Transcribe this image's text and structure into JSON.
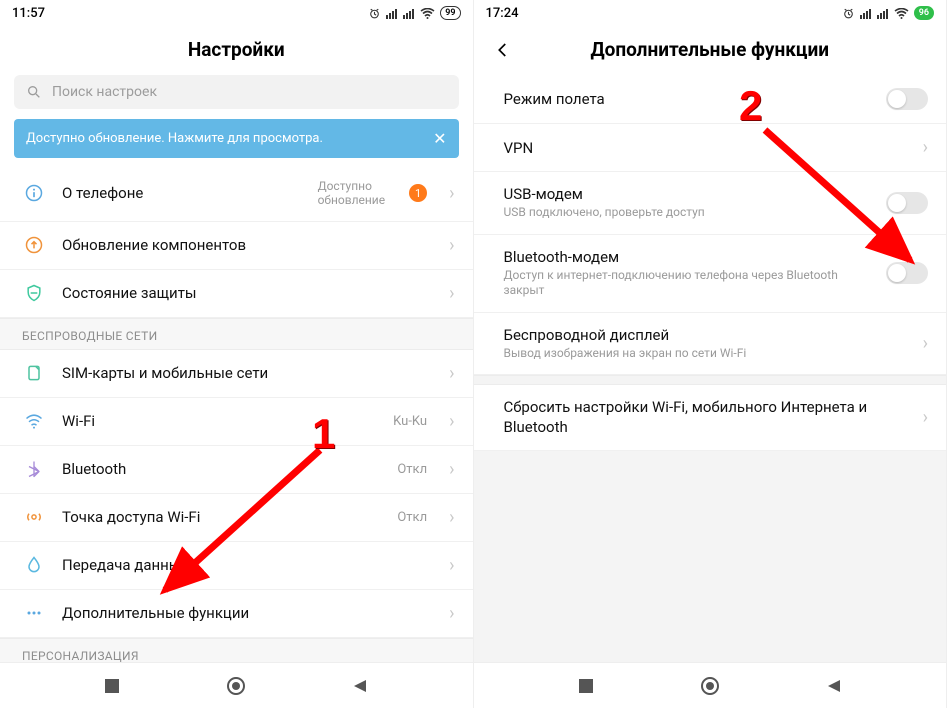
{
  "left": {
    "status_time": "11:57",
    "battery": "99",
    "title": "Настройки",
    "search_placeholder": "Поиск настроек",
    "banner_text": "Доступно обновление. Нажмите для просмотра.",
    "rows": {
      "about": {
        "label": "О телефоне",
        "value_line1": "Доступно",
        "value_line2": "обновление",
        "badge": "1"
      },
      "updates": {
        "label": "Обновление компонентов"
      },
      "security": {
        "label": "Состояние защиты"
      }
    },
    "group_wireless": "БЕСПРОВОДНЫЕ СЕТИ",
    "wireless": {
      "sim": {
        "label": "SIM-карты и мобильные сети"
      },
      "wifi": {
        "label": "Wi-Fi",
        "value": "Ku-Ku"
      },
      "bt": {
        "label": "Bluetooth",
        "value": "Откл"
      },
      "hotspot": {
        "label": "Точка доступа Wi-Fi",
        "value": "Откл"
      },
      "data": {
        "label": "Передача данных"
      },
      "more": {
        "label": "Дополнительные функции"
      }
    },
    "group_personal": "ПЕРСОНАЛИЗАЦИЯ"
  },
  "right": {
    "status_time": "17:24",
    "battery": "96",
    "title": "Дополнительные функции",
    "rows": {
      "airplane": {
        "label": "Режим полета"
      },
      "vpn": {
        "label": "VPN"
      },
      "usb": {
        "label": "USB-модем",
        "sub": "USB подключено, проверьте доступ"
      },
      "btmodem": {
        "label": "Bluetooth-модем",
        "sub": "Доступ к интернет-подключению телефона через Bluetooth закрыт"
      },
      "cast": {
        "label": "Беспроводной дисплей",
        "sub": "Вывод изображения на экран по сети Wi-Fi"
      },
      "reset": {
        "label": "Сбросить настройки Wi-Fi, мобильного Интернета и Bluetooth"
      }
    }
  },
  "annotations": {
    "n1": "1",
    "n2": "2"
  }
}
